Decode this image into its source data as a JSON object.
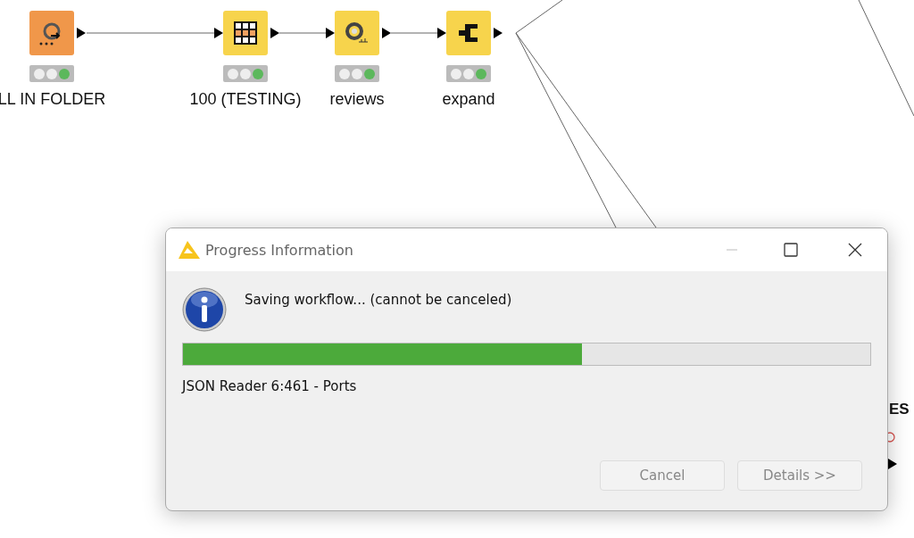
{
  "nodes": [
    {
      "label": "LL IN FOLDER",
      "kind": "loop",
      "executed": true
    },
    {
      "label": "100 (TESTING)",
      "kind": "table",
      "executed": true
    },
    {
      "label": "reviews",
      "kind": "json",
      "executed": true
    },
    {
      "label": "expand",
      "kind": "expand",
      "executed": true
    }
  ],
  "partial_node": {
    "label": "ES",
    "configured": false
  },
  "dialog": {
    "title": "Progress Information",
    "message": "Saving workflow... (cannot be canceled)",
    "progress": {
      "level": 0.58
    },
    "detail": "JSON Reader 6:461 - Ports",
    "buttons": [
      {
        "label": "Cancel",
        "disabled": true
      },
      {
        "label": "Details >>",
        "disabled": true
      }
    ]
  }
}
